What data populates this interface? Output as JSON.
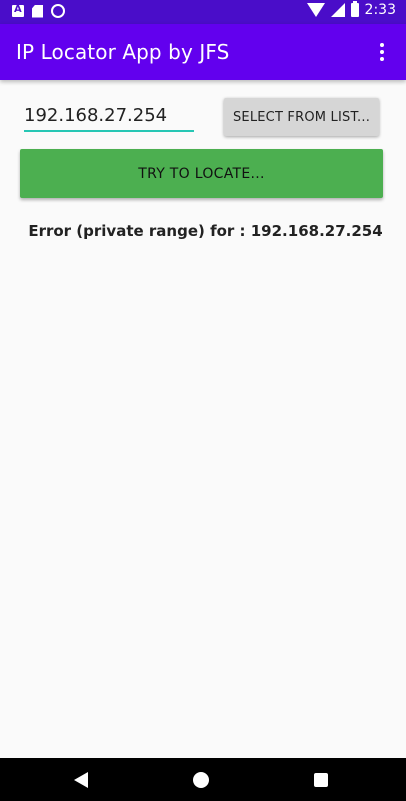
{
  "status_bar": {
    "time": "2:33",
    "left_icons": [
      "a-notification-icon",
      "sd-card-icon",
      "circle-ring-icon"
    ],
    "right_icons": [
      "wifi-icon",
      "cellular-icon",
      "battery-icon"
    ],
    "color": "#4a0dc9"
  },
  "app_bar": {
    "title": "IP Locator App by JFS",
    "menu_icon": "overflow-menu-icon",
    "color": "#6200ee"
  },
  "form": {
    "ip_value": "192.168.27.254",
    "select_label": "SELECT FROM LIST...",
    "locate_label": "TRY TO LOCATE...",
    "accent_color": "#26c6b4",
    "locate_color": "#4caf50"
  },
  "result": {
    "message": "Error (private range) for : 192.168.27.254"
  },
  "nav_bar": {
    "icons": [
      "back-icon",
      "home-icon",
      "recents-icon"
    ]
  }
}
